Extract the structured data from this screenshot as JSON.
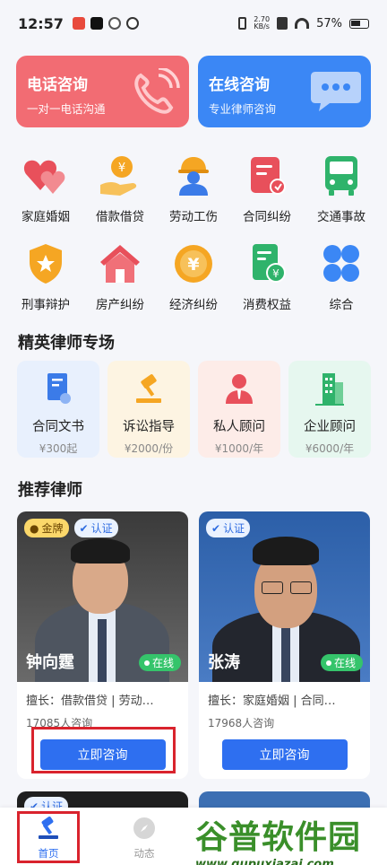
{
  "status_bar": {
    "time": "12:57",
    "net_speed": "2.70",
    "net_unit": "KB/s",
    "battery": "57%"
  },
  "consult": {
    "phone": {
      "title": "电话咨询",
      "subtitle": "一对一电话沟通",
      "color": "#f26c73"
    },
    "online": {
      "title": "在线咨询",
      "subtitle": "专业律师咨询",
      "color": "#3b87f5"
    }
  },
  "categories": [
    {
      "label": "家庭婚姻",
      "icon": "hearts-icon"
    },
    {
      "label": "借款借贷",
      "icon": "money-hand-icon"
    },
    {
      "label": "劳动工伤",
      "icon": "worker-icon"
    },
    {
      "label": "合同纠纷",
      "icon": "contract-icon"
    },
    {
      "label": "交通事故",
      "icon": "bus-icon"
    },
    {
      "label": "刑事辩护",
      "icon": "shield-icon"
    },
    {
      "label": "房产纠纷",
      "icon": "house-icon"
    },
    {
      "label": "经济纠纷",
      "icon": "coin-icon"
    },
    {
      "label": "消费权益",
      "icon": "receipt-icon"
    },
    {
      "label": "综合",
      "icon": "grid-icon"
    }
  ],
  "elite": {
    "title": "精英律师专场",
    "items": [
      {
        "name": "合同文书",
        "price": "¥300起",
        "bg": "#e8f0fd"
      },
      {
        "name": "诉讼指导",
        "price": "¥2000/份",
        "bg": "#fdf4e2"
      },
      {
        "name": "私人顾问",
        "price": "¥1000/年",
        "bg": "#fdece8"
      },
      {
        "name": "企业顾问",
        "price": "¥6000/年",
        "bg": "#e6f7ef"
      }
    ]
  },
  "recommend": {
    "title": "推荐律师",
    "lawyers": [
      {
        "name": "钟向霆",
        "gold_badge": "金牌",
        "cert_badge": "认证",
        "status": "在线",
        "specialty": "擅长：借款借贷 | 劳动…",
        "count": "17085人咨询",
        "button": "立即咨询"
      },
      {
        "name": "张涛",
        "cert_badge": "认证",
        "status": "在线",
        "specialty": "擅长：家庭婚姻 | 合同…",
        "count": "17968人咨询",
        "button": "立即咨询"
      }
    ],
    "next_row_badge": "认证"
  },
  "bottom_nav": {
    "home": "首页",
    "feed": "动态"
  },
  "watermark": {
    "text": "谷普软件园",
    "url": "www.gupuxiazai.com"
  }
}
